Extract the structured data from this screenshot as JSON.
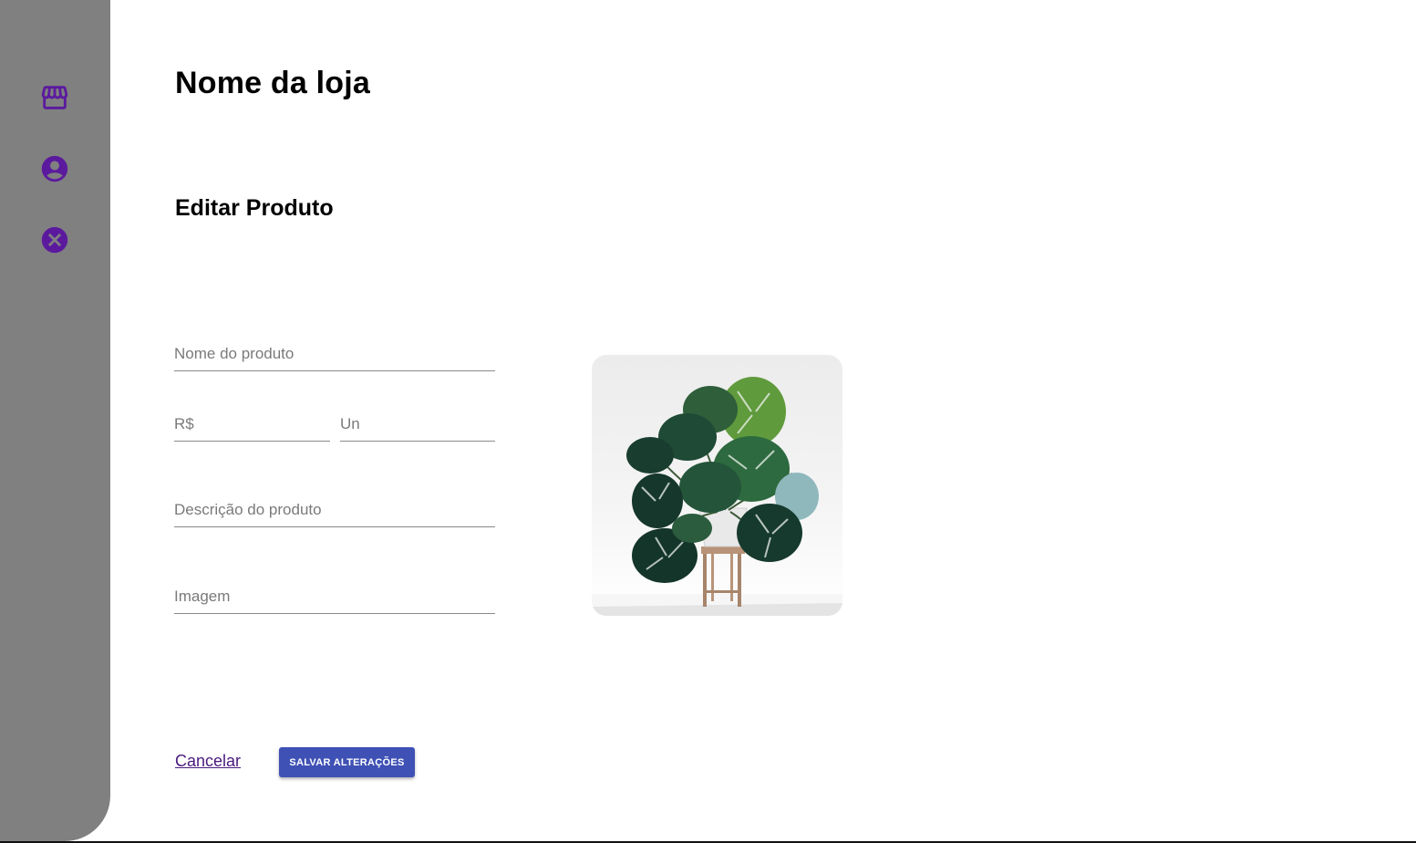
{
  "sidebar": {
    "accent_color": "#5b1a9e",
    "background_color": "#808080",
    "items": [
      {
        "icon": "store-icon"
      },
      {
        "icon": "account-circle-icon"
      },
      {
        "icon": "cancel-circle-icon"
      }
    ]
  },
  "header": {
    "store_name": "Nome da loja"
  },
  "form": {
    "title": "Editar Produto",
    "fields": {
      "product_name": {
        "placeholder": "Nome do produto",
        "value": ""
      },
      "price": {
        "placeholder": "R$",
        "value": ""
      },
      "unit": {
        "placeholder": "Un",
        "value": ""
      },
      "description": {
        "placeholder": "Descrição do produto",
        "value": ""
      },
      "image": {
        "placeholder": "Imagem",
        "value": ""
      }
    },
    "cancel_label": "Cancelar",
    "save_label": "SALVAR ALTERAÇÕES",
    "save_color": "#3f51b5"
  }
}
